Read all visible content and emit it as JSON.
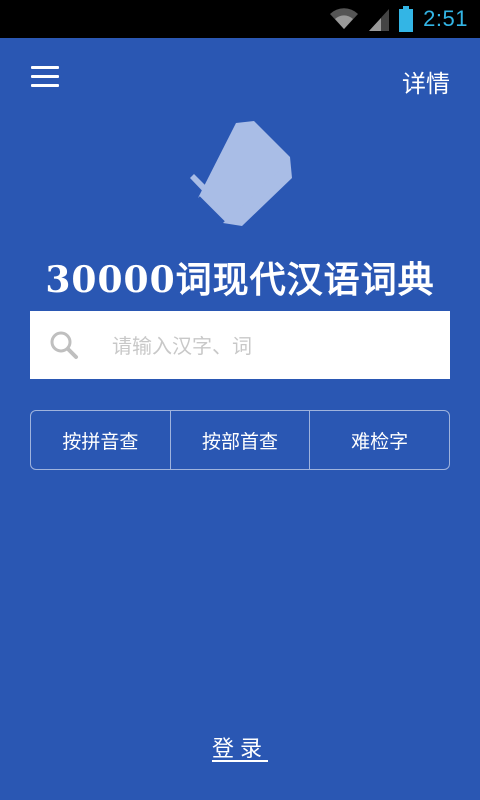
{
  "status_bar": {
    "time": "2:51",
    "icons": [
      "wifi-icon",
      "signal-icon",
      "battery-icon"
    ]
  },
  "header": {
    "menu_icon": "hamburger-menu-icon",
    "details_label": "详情"
  },
  "logo": {
    "icon": "book-logo-icon"
  },
  "app_title": "30000词现代汉语词典",
  "search": {
    "icon": "search-icon",
    "placeholder": "请输入汉字、词",
    "value": ""
  },
  "lookup_modes": [
    {
      "label": "按拼音查"
    },
    {
      "label": "按部首查"
    },
    {
      "label": "难检字"
    }
  ],
  "login_label": "登录",
  "colors": {
    "background": "#2a57b3",
    "status_bar": "#000000",
    "clock": "#33b5e5",
    "text": "#ffffff",
    "logo_fill": "#a9bde6"
  }
}
